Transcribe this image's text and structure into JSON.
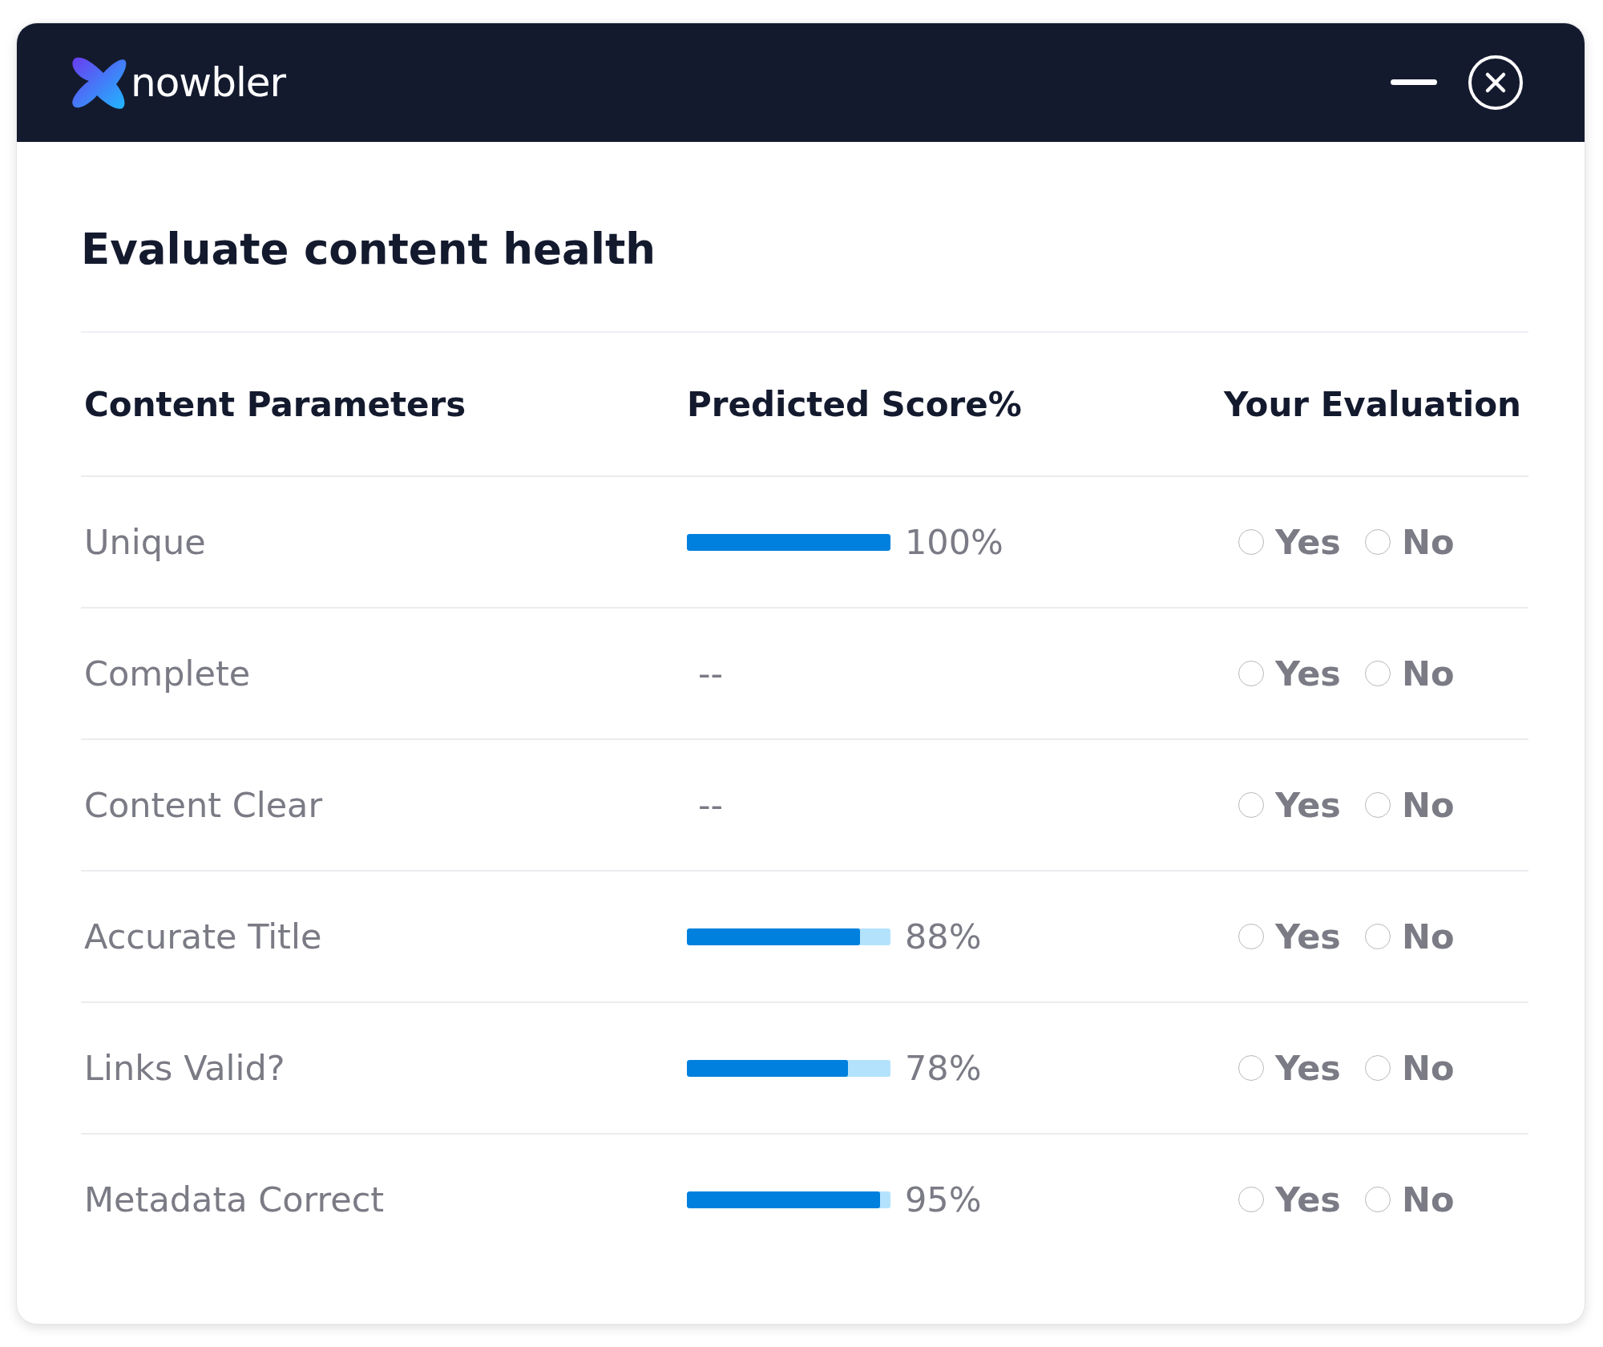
{
  "header": {
    "brand": "nowbler"
  },
  "title": "Evaluate content health",
  "columns": [
    "Content Parameters",
    "Predicted Score%",
    "Your Evaluation"
  ],
  "rows": [
    {
      "parameter": "Unique",
      "score": "100%",
      "level": 1.0,
      "options": [
        {
          "label": "Yes",
          "selected": false
        },
        {
          "label": "No",
          "selected": false
        }
      ]
    },
    {
      "parameter": "Complete",
      "score": "--",
      "options": [
        {
          "label": "Yes",
          "selected": false
        },
        {
          "label": "No",
          "selected": false
        }
      ]
    },
    {
      "parameter": "Content Clear",
      "score": "--",
      "options": [
        {
          "label": "Yes",
          "selected": false
        },
        {
          "label": "No",
          "selected": false
        }
      ]
    },
    {
      "parameter": "Accurate Title",
      "score": "88%",
      "level": 0.85,
      "options": [
        {
          "label": "Yes",
          "selected": false
        },
        {
          "label": "No",
          "selected": false
        }
      ]
    },
    {
      "parameter": "Links Valid?",
      "score": "78%",
      "level": 0.79,
      "options": [
        {
          "label": "Yes",
          "selected": false
        },
        {
          "label": "No",
          "selected": false
        }
      ]
    },
    {
      "parameter": "Metadata Correct",
      "score": "95%",
      "level": 0.95,
      "options": [
        {
          "label": "Yes",
          "selected": false
        },
        {
          "label": "No",
          "selected": false
        }
      ]
    }
  ]
}
